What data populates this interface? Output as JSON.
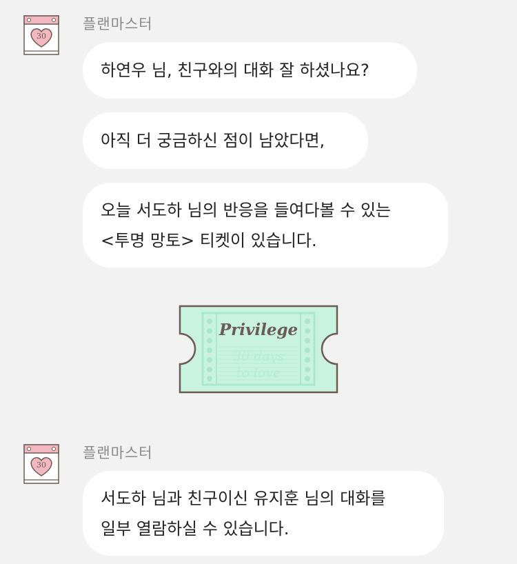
{
  "messages": [
    {
      "sender": "플랜마스터",
      "lines": [
        "하연우 님, 친구와의 대화 잘 하셨나요?"
      ]
    },
    {
      "lines": [
        "아직 더 궁금하신 점이 남았다면,"
      ]
    },
    {
      "lines": [
        "오늘 서도하 님의 반응을 들여다볼 수 있는",
        "<투명 망토> 티켓이 있습니다."
      ]
    },
    {
      "sender": "플랜마스터",
      "lines": [
        "서도하 님과 친구이신 유지훈 님의 대화를",
        "일부 열람하실 수 있습니다."
      ]
    }
  ],
  "avatar": {
    "badge_text": "30",
    "icon": "heart-calendar-icon"
  },
  "ticket": {
    "title": "Privilege",
    "watermark_lines": [
      "30 days",
      "to love"
    ],
    "colors": {
      "fill": "#c9f3df",
      "border": "#6b5b55",
      "inner": "#a9e8cc"
    }
  }
}
